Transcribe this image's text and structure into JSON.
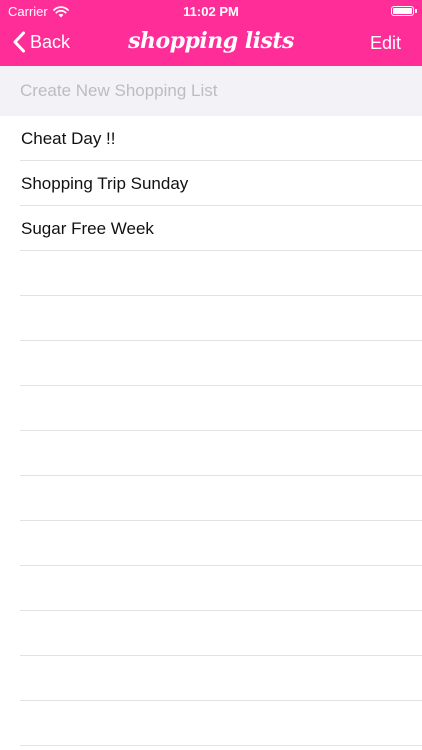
{
  "status_bar": {
    "carrier": "Carrier",
    "time": "11:02 PM"
  },
  "nav": {
    "back_label": "Back",
    "title": "shopping lists",
    "edit_label": "Edit"
  },
  "create": {
    "placeholder": "Create New Shopping List"
  },
  "lists": [
    {
      "label": "Cheat Day !!"
    },
    {
      "label": "Shopping Trip Sunday"
    },
    {
      "label": "Sugar Free Week"
    },
    {
      "label": ""
    },
    {
      "label": ""
    },
    {
      "label": ""
    },
    {
      "label": ""
    },
    {
      "label": ""
    },
    {
      "label": ""
    },
    {
      "label": ""
    },
    {
      "label": ""
    },
    {
      "label": ""
    },
    {
      "label": ""
    },
    {
      "label": ""
    }
  ],
  "colors": {
    "accent": "#ff2d98",
    "create_background": "#f2f2f7",
    "separator": "#e2e2e6"
  },
  "icons": {
    "wifi": "wifi-icon",
    "battery": "battery-icon",
    "back": "chevron-left-icon"
  }
}
